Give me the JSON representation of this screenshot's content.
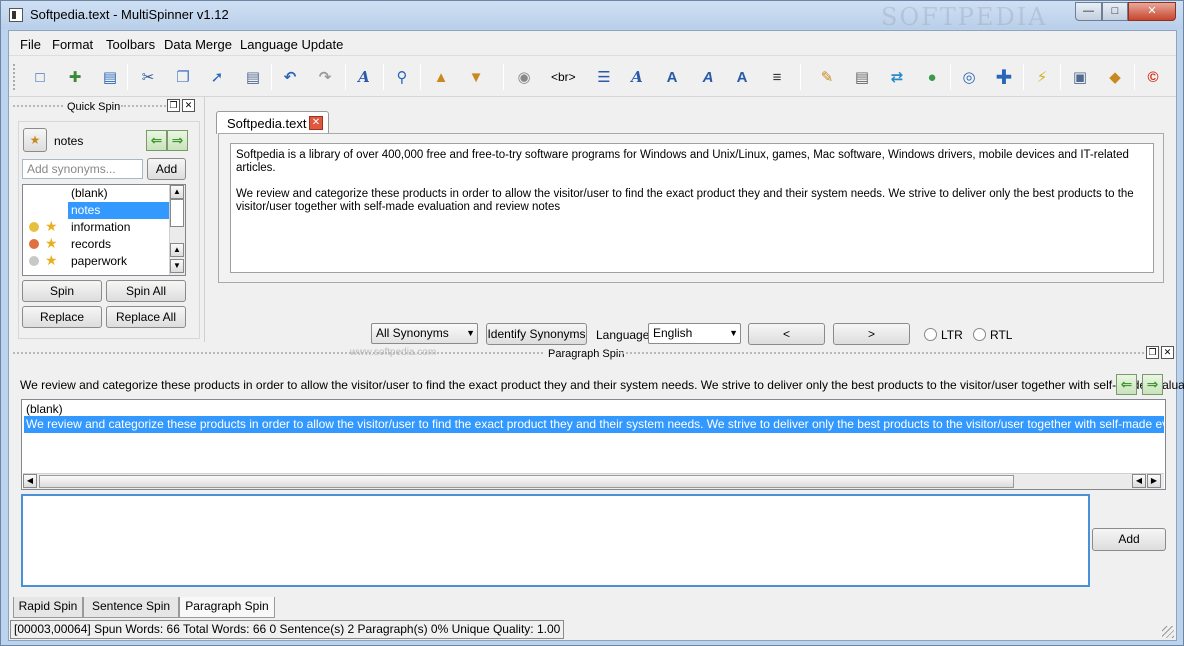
{
  "window": {
    "title": "Softpedia.text - MultiSpinner v1.12",
    "watermark": "SOFTPEDIA"
  },
  "menu": [
    "File",
    "Format",
    "Toolbars",
    "Data Merge",
    "Language Update"
  ],
  "toolbar": {
    "br_label": "<br>",
    "icons": [
      "open-icon",
      "new-icon",
      "copy-doc-icon",
      "cut-icon",
      "copy-icon",
      "paste-icon",
      "save-icon",
      "undo-icon",
      "redo-icon",
      "font-icon",
      "search-icon",
      "export-icon",
      "import-icon",
      "disc-icon",
      "list-icon",
      "italic-a-icon",
      "outline-a-icon",
      "slant-a-icon",
      "bold-a-icon",
      "align-icon",
      "note-icon",
      "doc-icon",
      "sync-icon",
      "globe-icon",
      "world-icon",
      "plus-icon",
      "lightning-icon",
      "computer-icon",
      "tag-icon",
      "copyright-icon"
    ]
  },
  "quick_spin": {
    "title": "Quick Spin",
    "word": "notes",
    "synonym_placeholder": "Add synonyms...",
    "add_label": "Add",
    "items": [
      "(blank)",
      "notes",
      "information",
      "records",
      "paperwork"
    ],
    "selected_index": 1,
    "spin_label": "Spin",
    "spin_all_label": "Spin All",
    "replace_label": "Replace",
    "replace_all_label": "Replace All"
  },
  "editor": {
    "tab_label": "Softpedia.text",
    "paragraph1": "Softpedia is a library of over 400,000 free and free-to-try software programs for Windows and Unix/Linux, games, Mac software, Windows drivers, mobile devices and IT-related articles.",
    "paragraph2": "We review and categorize these products in order to allow the visitor/user to find the exact product they and their system needs. We strive to deliver only the best products to the visitor/user together with self-made evaluation and review notes",
    "synonyms_combo": "All Synonyms",
    "identify_label": "Identify Synonyms",
    "language_label": "Language",
    "language_value": "English",
    "prev_label": "<",
    "next_label": ">",
    "ltr_label": "LTR",
    "rtl_label": "RTL",
    "watermark_url": "www.softpedia.com"
  },
  "paragraph_spin": {
    "title": "Paragraph Spin",
    "current_text": "We review and categorize these products in order to allow the visitor/user to find the exact product they and their system needs. We strive to deliver only the best products to the visitor/user together with self-made evaluation",
    "items": [
      "(blank)",
      "We review and categorize these products in order to allow the visitor/user to find the exact product they and their system needs. We strive to deliver only the best products to the visitor/user together with self-made evaluation and review notes"
    ],
    "add_label": "Add"
  },
  "bottom_tabs": [
    "Rapid Spin",
    "Sentence Spin",
    "Paragraph Spin"
  ],
  "status": "[00003,00064]  Spun Words: 66  Total Words: 66  0 Sentence(s)  2 Paragraph(s)  0% Unique  Quality: 1.00"
}
